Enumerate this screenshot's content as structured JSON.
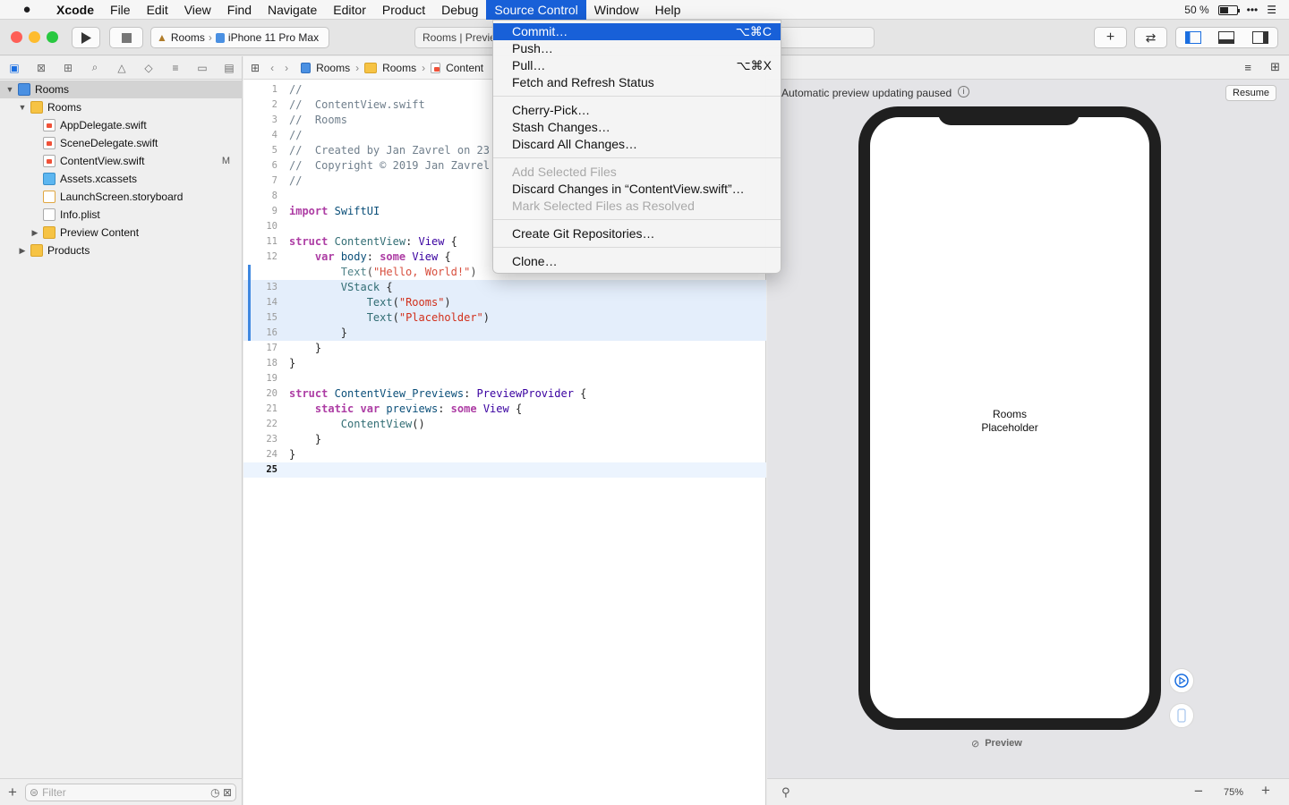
{
  "menubar": {
    "app": "Xcode",
    "items": [
      "File",
      "Edit",
      "View",
      "Find",
      "Navigate",
      "Editor",
      "Product",
      "Debug",
      "Source Control",
      "Window",
      "Help"
    ],
    "active_item": "Source Control",
    "battery_text": "50 %",
    "battery_level": 0.5
  },
  "toolbar": {
    "scheme_project": "Rooms",
    "scheme_device": "iPhone 11 Pro Max",
    "activity_text": "Rooms | Previe"
  },
  "source_control_menu": {
    "items": [
      {
        "label": "Commit…",
        "shortcut": "⌥⌘C",
        "state": "highlighted"
      },
      {
        "label": "Push…",
        "shortcut": "",
        "state": "enabled"
      },
      {
        "label": "Pull…",
        "shortcut": "⌥⌘X",
        "state": "enabled"
      },
      {
        "label": "Fetch and Refresh Status",
        "shortcut": "",
        "state": "enabled"
      },
      {
        "label": "Cherry-Pick…",
        "shortcut": "",
        "state": "enabled"
      },
      {
        "label": "Stash Changes…",
        "shortcut": "",
        "state": "enabled"
      },
      {
        "label": "Discard All Changes…",
        "shortcut": "",
        "state": "enabled"
      },
      {
        "label": "Add Selected Files",
        "shortcut": "",
        "state": "disabled"
      },
      {
        "label": "Discard Changes in “ContentView.swift”…",
        "shortcut": "",
        "state": "enabled"
      },
      {
        "label": "Mark Selected Files as Resolved",
        "shortcut": "",
        "state": "disabled"
      },
      {
        "label": "Create Git Repositories…",
        "shortcut": "",
        "state": "enabled"
      },
      {
        "label": "Clone…",
        "shortcut": "",
        "state": "enabled"
      }
    ]
  },
  "navigator": {
    "tree": [
      {
        "label": "Rooms",
        "kind": "project",
        "selected": true
      },
      {
        "label": "Rooms",
        "kind": "folder"
      },
      {
        "label": "AppDelegate.swift",
        "kind": "swift"
      },
      {
        "label": "SceneDelegate.swift",
        "kind": "swift"
      },
      {
        "label": "ContentView.swift",
        "kind": "swift",
        "badge": "M"
      },
      {
        "label": "Assets.xcassets",
        "kind": "assets"
      },
      {
        "label": "LaunchScreen.storyboard",
        "kind": "storyboard"
      },
      {
        "label": "Info.plist",
        "kind": "plist"
      },
      {
        "label": "Preview Content",
        "kind": "folder"
      },
      {
        "label": "Products",
        "kind": "folder"
      }
    ],
    "filter_placeholder": "Filter"
  },
  "jumpbar": {
    "crumbs": [
      "Rooms",
      "Rooms",
      "Content"
    ]
  },
  "editor": {
    "lines": [
      {
        "n": "1",
        "text": "//"
      },
      {
        "n": "2",
        "text": "//  ContentView.swift"
      },
      {
        "n": "3",
        "text": "//  Rooms"
      },
      {
        "n": "4",
        "text": "//"
      },
      {
        "n": "5",
        "text": "//  Created by Jan Zavrel on 23"
      },
      {
        "n": "6",
        "text": "//  Copyright © 2019 Jan Zavrel"
      },
      {
        "n": "7",
        "text": "//"
      },
      {
        "n": "8",
        "text": ""
      },
      {
        "n": "9",
        "text": "import SwiftUI"
      },
      {
        "n": "10",
        "text": ""
      },
      {
        "n": "11",
        "text": "struct ContentView: View {"
      },
      {
        "n": "12",
        "text": "    var body: some View {"
      },
      {
        "n": "",
        "text": "        Text(\"Hello, World!\")"
      },
      {
        "n": "13",
        "text": "        VStack {"
      },
      {
        "n": "14",
        "text": "            Text(\"Rooms\")"
      },
      {
        "n": "15",
        "text": "            Text(\"Placeholder\")"
      },
      {
        "n": "16",
        "text": "        }"
      },
      {
        "n": "17",
        "text": "    }"
      },
      {
        "n": "18",
        "text": "}"
      },
      {
        "n": "19",
        "text": ""
      },
      {
        "n": "20",
        "text": "struct ContentView_Previews: PreviewProvider {"
      },
      {
        "n": "21",
        "text": "    static var previews: some View {"
      },
      {
        "n": "22",
        "text": "        ContentView()"
      },
      {
        "n": "23",
        "text": "    }"
      },
      {
        "n": "24",
        "text": "}"
      },
      {
        "n": "25",
        "text": ""
      }
    ]
  },
  "canvas": {
    "paused_text": "Automatic preview updating paused",
    "resume_label": "Resume",
    "phone_text": [
      "Rooms",
      "Placeholder"
    ],
    "preview_label": "Preview",
    "zoom": "75%"
  }
}
